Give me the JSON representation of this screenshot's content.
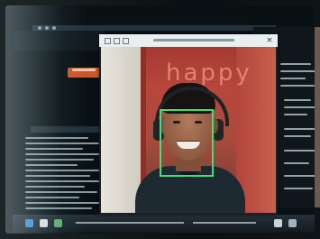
{
  "camera_window": {
    "detected_emotion": "happy",
    "close_glyph": "×"
  },
  "colors": {
    "face_box": "#39e27a",
    "label": "#e0836e",
    "wall": "#b8463c",
    "status_button": "#d0552e"
  },
  "icons": {
    "camera_close": "close-icon",
    "headphones": "headphones-icon"
  }
}
